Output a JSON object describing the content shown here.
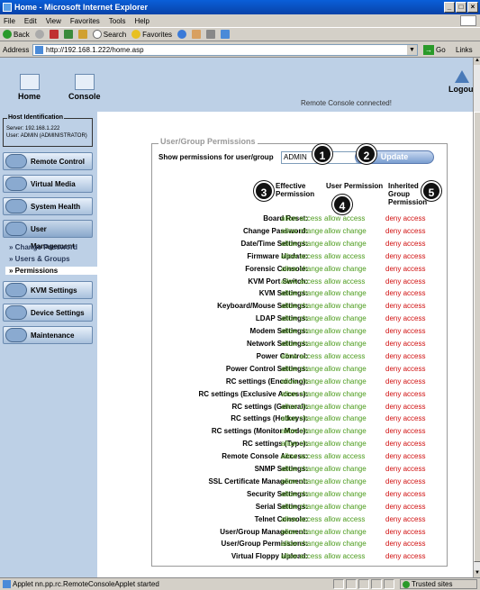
{
  "window": {
    "title": "Home - Microsoft Internet Explorer",
    "buttons": [
      "_",
      "□",
      "×"
    ]
  },
  "menu": [
    "File",
    "Edit",
    "View",
    "Favorites",
    "Tools",
    "Help"
  ],
  "toolbar": {
    "back": "Back",
    "search": "Search",
    "favorites": "Favorites"
  },
  "address": {
    "label": "Address",
    "url": "http://192.168.1.222/home.asp",
    "go": "Go",
    "links": "Links"
  },
  "header": {
    "home": "Home",
    "console": "Console",
    "status": "Remote Console connected!",
    "logout": "Logout"
  },
  "host": {
    "title": "Host Identification",
    "server_label": "Server:",
    "server": "192.168.1.222",
    "user_label": "User:",
    "user": "ADMIN (ADMINISTRATOR)"
  },
  "sidebar": {
    "items": [
      "Remote Control",
      "Virtual Media",
      "System Health",
      "User Management",
      "KVM Settings",
      "Device Settings",
      "Maintenance"
    ],
    "subitems": [
      "Change Password",
      "Users & Groups",
      "Permissions"
    ]
  },
  "panel": {
    "legend": "User/Group Permissions",
    "show_label": "Show permissions for user/group",
    "selected_user": "ADMIN",
    "update_button": "Update",
    "col_effective": "Effective Permission",
    "col_user": "User Permission",
    "col_inherited": "Inherited Group Permission"
  },
  "markers": [
    "1",
    "2",
    "3",
    "4",
    "5"
  ],
  "permissions": [
    {
      "label": "Board Reset:",
      "eff": "allow access",
      "usr": "allow access",
      "inh": "deny access"
    },
    {
      "label": "Change Password:",
      "eff": "allow change",
      "usr": "allow change",
      "inh": "deny access"
    },
    {
      "label": "Date/Time Settings:",
      "eff": "allow change",
      "usr": "allow change",
      "inh": "deny access"
    },
    {
      "label": "Firmware Update:",
      "eff": "allow access",
      "usr": "allow access",
      "inh": "deny access"
    },
    {
      "label": "Forensic Console:",
      "eff": "allow change",
      "usr": "allow change",
      "inh": "deny access"
    },
    {
      "label": "KVM Port Switch:",
      "eff": "allow access",
      "usr": "allow access",
      "inh": "deny access"
    },
    {
      "label": "KVM Settings:",
      "eff": "allow change",
      "usr": "allow change",
      "inh": "deny access"
    },
    {
      "label": "Keyboard/Mouse Settings:",
      "eff": "allow change",
      "usr": "allow change",
      "inh": "deny access"
    },
    {
      "label": "LDAP Settings:",
      "eff": "allow change",
      "usr": "allow change",
      "inh": "deny access"
    },
    {
      "label": "Modem Settings:",
      "eff": "allow change",
      "usr": "allow change",
      "inh": "deny access"
    },
    {
      "label": "Network Settings:",
      "eff": "allow change",
      "usr": "allow change",
      "inh": "deny access"
    },
    {
      "label": "Power Control:",
      "eff": "allow access",
      "usr": "allow access",
      "inh": "deny access"
    },
    {
      "label": "Power Control Settings:",
      "eff": "allow change",
      "usr": "allow change",
      "inh": "deny access"
    },
    {
      "label": "RC settings (Encoding):",
      "eff": "allow change",
      "usr": "allow change",
      "inh": "deny access"
    },
    {
      "label": "RC settings (Exclusive Access):",
      "eff": "allow change",
      "usr": "allow change",
      "inh": "deny access"
    },
    {
      "label": "RC settings (General):",
      "eff": "allow change",
      "usr": "allow change",
      "inh": "deny access"
    },
    {
      "label": "RC settings (Hotkeys):",
      "eff": "allow change",
      "usr": "allow change",
      "inh": "deny access"
    },
    {
      "label": "RC settings (Monitor Mode):",
      "eff": "allow change",
      "usr": "allow change",
      "inh": "deny access"
    },
    {
      "label": "RC settings (Type):",
      "eff": "allow change",
      "usr": "allow change",
      "inh": "deny access"
    },
    {
      "label": "Remote Console Access:",
      "eff": "allow access",
      "usr": "allow access",
      "inh": "deny access"
    },
    {
      "label": "SNMP Settings:",
      "eff": "allow change",
      "usr": "allow change",
      "inh": "deny access"
    },
    {
      "label": "SSL Certificate Management:",
      "eff": "allow change",
      "usr": "allow change",
      "inh": "deny access"
    },
    {
      "label": "Security Settings:",
      "eff": "allow change",
      "usr": "allow change",
      "inh": "deny access"
    },
    {
      "label": "Serial Settings:",
      "eff": "allow change",
      "usr": "allow change",
      "inh": "deny access"
    },
    {
      "label": "Telnet Console:",
      "eff": "allow access",
      "usr": "allow access",
      "inh": "deny access"
    },
    {
      "label": "User/Group Management:",
      "eff": "allow change",
      "usr": "allow change",
      "inh": "deny access"
    },
    {
      "label": "User/Group Permissions:",
      "eff": "allow change",
      "usr": "allow change",
      "inh": "deny access"
    },
    {
      "label": "Virtual Floppy Upload:",
      "eff": "allow access",
      "usr": "allow access",
      "inh": "deny access"
    }
  ],
  "statusbar": {
    "text": "Applet nn.pp.rc.RemoteConsoleApplet started",
    "zone": "Trusted sites"
  },
  "colors": {
    "allow": "#4a9a1a",
    "deny": "#d01010",
    "sidebar_bg": "#bdd0e6"
  }
}
